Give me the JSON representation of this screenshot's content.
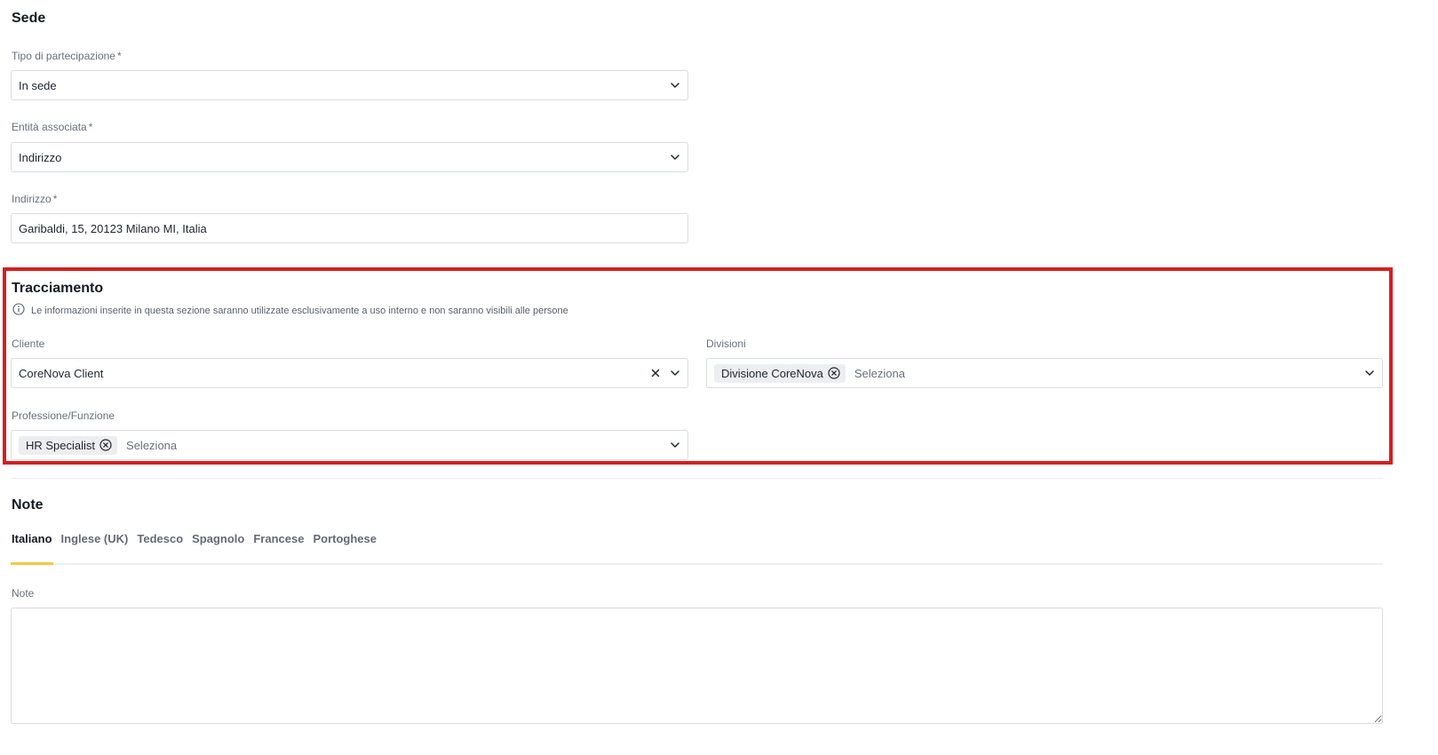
{
  "sede": {
    "title": "Sede",
    "tipo": {
      "label": "Tipo di partecipazione",
      "required_mark": "*",
      "value": "In sede"
    },
    "entita": {
      "label": "Entità associata",
      "required_mark": "*",
      "value": "Indirizzo"
    },
    "indirizzo": {
      "label": "Indirizzo",
      "required_mark": "*",
      "value": "Garibaldi, 15, 20123 Milano MI, Italia"
    }
  },
  "tracciamento": {
    "title": "Tracciamento",
    "info": "Le informazioni inserite in questa sezione saranno utilizzate esclusivamente a uso interno e non saranno visibili alle persone",
    "cliente": {
      "label": "Cliente",
      "value": "CoreNova Client"
    },
    "divisioni": {
      "label": "Divisioni",
      "tags": [
        "Divisione CoreNova"
      ],
      "placeholder": "Seleziona"
    },
    "professione": {
      "label": "Professione/Funzione",
      "tags": [
        "HR Specialist"
      ],
      "placeholder": "Seleziona"
    },
    "highlight_color": "#d81e1e"
  },
  "note": {
    "title": "Note",
    "tabs": [
      "Italiano",
      "Inglese (UK)",
      "Tedesco",
      "Spagnolo",
      "Francese",
      "Portoghese"
    ],
    "active_tab": "Italiano",
    "accent_color": "#f5c842",
    "field_label": "Note",
    "value": ""
  },
  "icons": {
    "chevron": "chevron-down-icon",
    "clear": "close-icon",
    "tag_remove": "circle-x-icon",
    "info": "info-icon"
  }
}
